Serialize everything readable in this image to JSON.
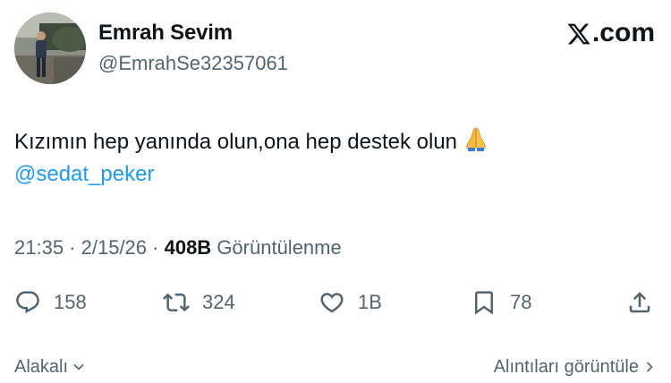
{
  "author": {
    "display_name": "Emrah Sevim",
    "handle": "@EmrahSe32357061"
  },
  "brand": {
    "text": ".com"
  },
  "tweet": {
    "line1": "Kızımın hep yanında olun,ona hep destek olun",
    "emoji": "folded-hands-emoji",
    "mention": "@sedat_peker"
  },
  "meta": {
    "time": "21:35",
    "separator1": " · ",
    "date": "2/15/26",
    "separator2": " · ",
    "views_count": "408B",
    "views_label": "Görüntülenme"
  },
  "actions": {
    "replies": "158",
    "reposts": "324",
    "likes": "1B",
    "bookmarks": "78"
  },
  "footer": {
    "relevant_label": "Alakalı",
    "quotes_label": "Alıntıları görüntüle"
  },
  "colors": {
    "text": "#0f1419",
    "secondary": "#536471",
    "link": "#1d9bf0"
  }
}
